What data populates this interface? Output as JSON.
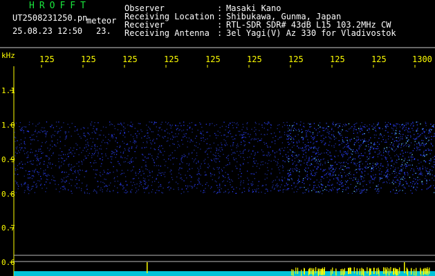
{
  "header": {
    "app_name": "HROFFT",
    "filename": "UT2508231250.pn",
    "tag": "meteor",
    "datetime": "25.08.23 12:50",
    "count": "23."
  },
  "station": [
    {
      "label": "Observer",
      "value": "Masaki Kano"
    },
    {
      "label": "Receiving Location",
      "value": "Shibukawa, Gunma, Japan"
    },
    {
      "label": "Receiver",
      "value": "RTL-SDR SDR# 43dB L15 103.2MHz CW"
    },
    {
      "label": "Receiving Antenna",
      "value": "3el Yagi(V) Az 330 for Vladivostok"
    }
  ],
  "axes": {
    "y_unit": "kHz",
    "x_ticks": [
      "125",
      "125",
      "125",
      "125",
      "125",
      "125",
      "125",
      "125",
      "125",
      "1300"
    ],
    "y_ticks": [
      "1.1",
      "1.0",
      "0.9",
      "0.8",
      "0.7",
      "0.6"
    ]
  },
  "colors": {
    "background": "#000000",
    "axis_text": "#ffff00",
    "app_name": "#19e63c",
    "text": "#ffffff",
    "signal": "#2a3cff",
    "baseline": "#00e5ff"
  }
}
